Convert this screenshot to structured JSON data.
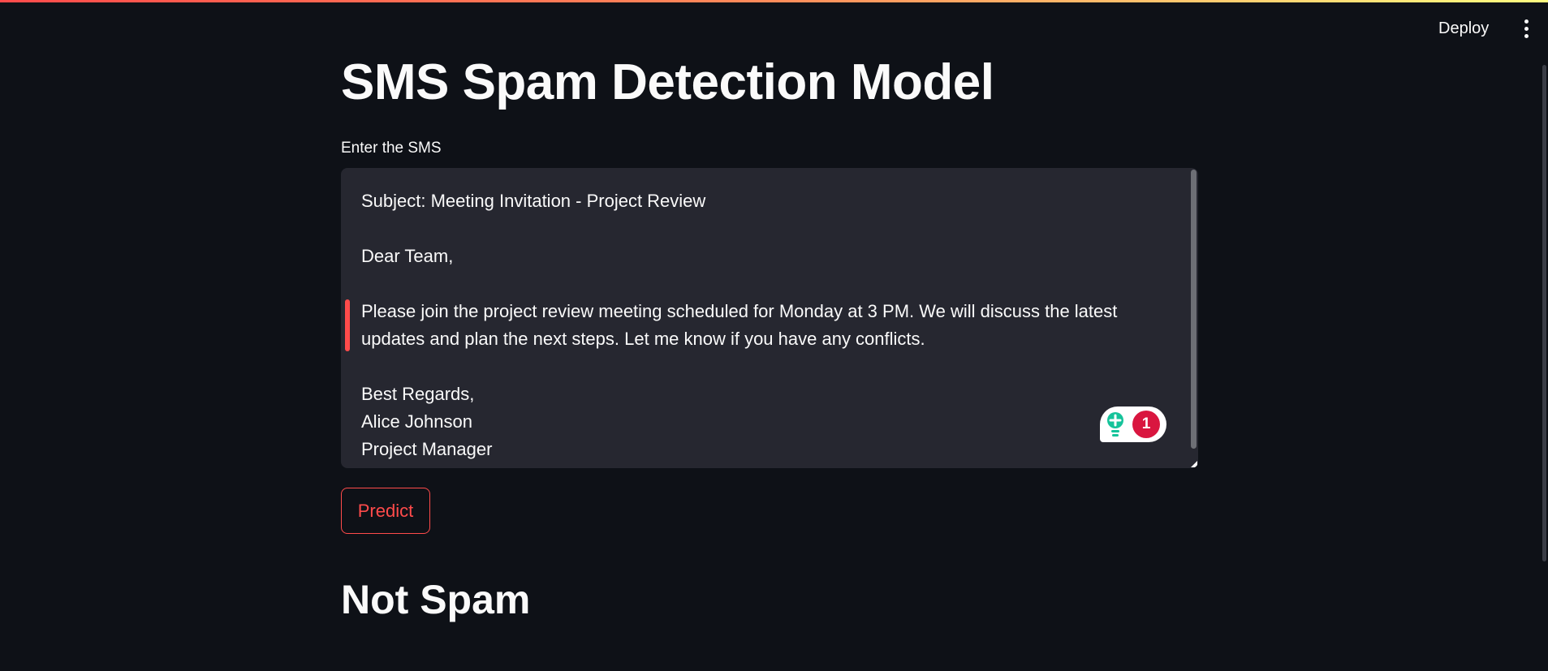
{
  "header": {
    "deploy_label": "Deploy",
    "menu_icon": "kebab-menu-icon"
  },
  "main": {
    "title": "SMS Spam Detection Model",
    "input_label": "Enter the SMS",
    "sms_value": "Subject: Meeting Invitation - Project Review\n\nDear Team,\n\nPlease join the project review meeting scheduled for Monday at 3 PM. We will discuss the latest updates and plan the next steps. Let me know if you have any conflicts.\n\nBest Regards,\nAlice Johnson\nProject Manager",
    "predict_label": "Predict",
    "result": "Not Spam"
  },
  "grammar_widget": {
    "icon": "lightbulb-icon",
    "count": "1"
  },
  "colors": {
    "background": "#0e1117",
    "accent": "#ff4b4b",
    "textarea_bg": "#262730",
    "text": "#fafafa",
    "badge": "#d9163f",
    "bulb": "#15c39a"
  }
}
